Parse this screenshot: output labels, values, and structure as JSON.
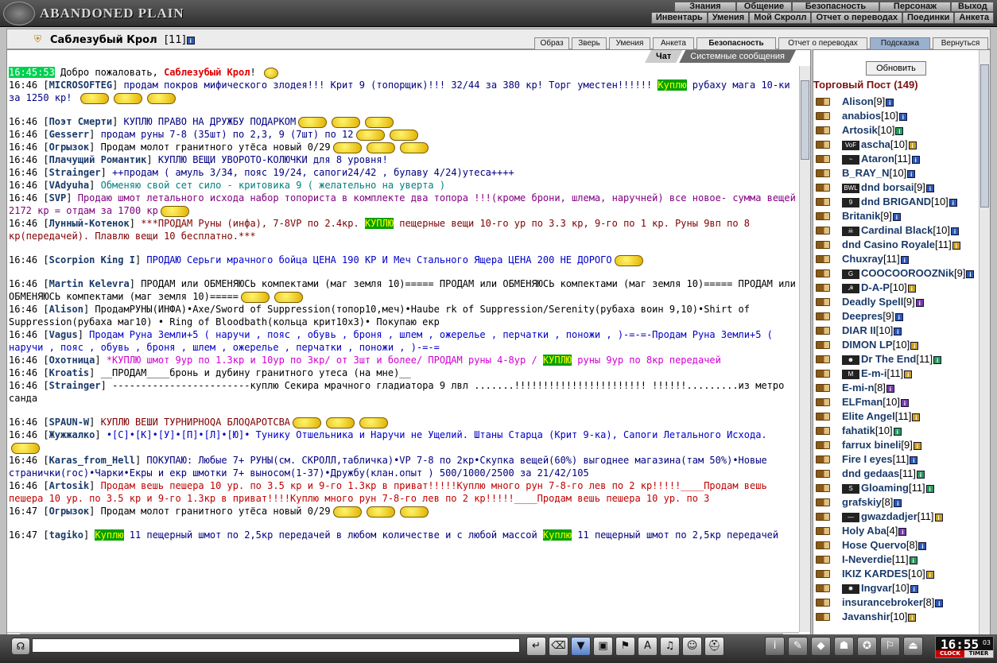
{
  "app": {
    "title": "ABANDONED PLAIN"
  },
  "nav_top": [
    "Знания",
    "Общение",
    "Безопасность",
    "Персонаж",
    "Выход"
  ],
  "nav_sub": [
    "Инвентарь",
    "Умения",
    "Мой Скролл",
    "Отчет о переводах",
    "Поединки",
    "Анкета"
  ],
  "header": {
    "player_name": "Саблезубый Крол",
    "level": "[11]",
    "info_icon": "i",
    "tabs": [
      {
        "label": "Образ",
        "bold": false
      },
      {
        "label": "Зверь",
        "bold": false
      },
      {
        "label": "Умения",
        "bold": false
      },
      {
        "label": "Анкета",
        "bold": false
      },
      {
        "label": "Безопасность",
        "bold": true
      },
      {
        "label": "Отчет о переводах",
        "bold": false
      },
      {
        "label": "Подсказка",
        "bold": false,
        "selected": true
      },
      {
        "label": "Вернуться",
        "bold": false
      }
    ]
  },
  "chat": {
    "tabs": [
      "Чат",
      "Системные сообщения"
    ],
    "welcome_time": "16:45:53",
    "welcome_prefix": "Добро пожаловать, ",
    "welcome_name": "Саблезубый Крол",
    "welcome_suffix": "!",
    "messages": [
      {
        "time": "16:46",
        "name": "MICROSOFTEG",
        "color": "navy",
        "parts": [
          {
            "t": "продам покров мифического злодея!!! Крит 9 (топорщик)!!! 32/44 за 380 кр! Торг уместен!!!!!! "
          },
          {
            "t": "Куплю",
            "hl": true
          },
          {
            "t": " рубаху мага 10-ки за 1250 кр! "
          }
        ],
        "emo": 3
      },
      {
        "time": "16:46",
        "name": "Поэт Смерти",
        "color": "navy",
        "parts": [
          {
            "t": "КУПЛЮ ПРАВО НА ДРУЖБУ ПОДАРКОМ"
          }
        ],
        "emo": 3,
        "gap": true
      },
      {
        "time": "16:46",
        "name": "Gesserr",
        "color": "navy",
        "parts": [
          {
            "t": "продам руны 7-8 (35шт) по 2,3, 9 (7шт) по 12"
          }
        ],
        "emo": 2
      },
      {
        "time": "16:46",
        "name": "Огрызок",
        "color": "black",
        "parts": [
          {
            "t": "Продам молот гранитного утёса новый 0/29"
          }
        ],
        "emo": 3
      },
      {
        "time": "16:46",
        "name": "Плачущий Романтик",
        "color": "navy",
        "parts": [
          {
            "t": "КУПЛЮ ВЕЩИ УВОРОТО-КОЛЮЧКИ для 8 уровня!"
          }
        ],
        "emo": 0
      },
      {
        "time": "16:46",
        "name": "Strainger",
        "color": "navy",
        "parts": [
          {
            "t": "++продам ( амуль 3/34, пояс 19/24, сапоги24/42 , булаву 4/24)утеса++++"
          }
        ],
        "emo": 0
      },
      {
        "time": "16:46",
        "name": "VAdyuha",
        "color": "teal",
        "parts": [
          {
            "t": "Обменяю свой сет сило - критовика 9 ( желательно на уверта )"
          }
        ],
        "emo": 0
      },
      {
        "time": "16:46",
        "name": "SVP",
        "color": "purple",
        "parts": [
          {
            "t": "Продаю шмот летального исхода набор топориста в комплекте два топора !!!(кроме брони, шлема, наручней) все новое- сумма вещей 2172 кр = отдам за 1700 кр"
          }
        ],
        "emo": 1
      },
      {
        "time": "16:46",
        "name": "Лунный-Котенок",
        "color": "maroon",
        "parts": [
          {
            "t": "***ПРОДАМ Руны (инфа), 7-8VP по 2.4кр. "
          },
          {
            "t": "КУПЛЮ",
            "hl": true
          },
          {
            "t": " пещерные вещи 10-го ур по 3.3 кр, 9-го по 1 кр. Руны 9вп по 8 кр(передачей). Плавлю вещи 10 бесплатно.***"
          }
        ],
        "emo": 0
      },
      {
        "time": "16:46",
        "name": "Scorpion King I",
        "color": "blue",
        "parts": [
          {
            "t": "ПРОДАЮ Серьги мрачного бойца ЦЕНА 190 КР И Меч Стального Ящера ЦЕНА 200 НЕ ДОРОГО"
          }
        ],
        "emo": 1,
        "gap": true
      },
      {
        "time": "16:46",
        "name": "Martin Kelevra",
        "color": "black",
        "parts": [
          {
            "t": "ПРОДАМ или ОБМЕНЯЮСЬ компектами (маг земля 10)===== ПРОДАМ или ОБМЕНЯЮСЬ компектами (маг земля 10)===== ПРОДАМ или ОБМЕНЯЮСЬ компектами (маг земля 10)====="
          }
        ],
        "emo": 2,
        "gap": true
      },
      {
        "time": "16:46",
        "name": "Alison",
        "color": "black",
        "parts": [
          {
            "t": "ПродамРУНЫ(ИНФА)•Axe/Sword of Suppression(топор10,меч)•Haube rk of Suppression/Serenity(рубаха воин 9,10)•Shirt of Suppression(рубаха маг10) • Ring of Bloodbath(кольца крит10x3)• Покупаю екр"
          }
        ],
        "emo": 0
      },
      {
        "time": "16:46",
        "name": "Vagus",
        "color": "blue",
        "parts": [
          {
            "t": "Продам Руна Земли+5 ( наручи , пояс , обувь , броня , шлем , ожерелье , перчатки , поножи , )-=-=-Продам Руна Земли+5 ( наручи , пояс , обувь , броня , шлем , ожерелье , перчатки , поножи , )-=-="
          }
        ],
        "emo": 0
      },
      {
        "time": "16:46",
        "name": "Охотница",
        "color": "magenta",
        "parts": [
          {
            "t": "*КУПЛЮ шмот 9ур по 1.3кр и 10ур по 3кр/ от 3шт и более/ ПРОДАМ руны 4-8ур / "
          },
          {
            "t": "КУПЛЮ",
            "hl": true
          },
          {
            "t": " руны 9ур по 8кр передачей"
          }
        ],
        "emo": 0
      },
      {
        "time": "16:46",
        "name": "Kroatis",
        "color": "black",
        "parts": [
          {
            "t": "__ПРОДАМ____бронь и дубину гранитного утеса (на мне)__"
          }
        ],
        "emo": 0
      },
      {
        "time": "16:46",
        "name": "Strainger",
        "color": "black",
        "parts": [
          {
            "t": "------------------------куплю Секира мрачного гладиатора 9 лвл .......!!!!!!!!!!!!!!!!!!!!!!! !!!!!!.........из метро санда"
          }
        ],
        "emo": 0
      },
      {
        "time": "16:46",
        "name": "SPAUN-W",
        "color": "maroon",
        "parts": [
          {
            "t": "КУПЛЮ ВЕШИ ТУРНИРНОQА БЛОQАРОТСВА"
          }
        ],
        "emo": 3,
        "gap": true
      },
      {
        "time": "16:46",
        "name": "Жужжалко",
        "color": "blue",
        "parts": [
          {
            "t": "•[С]•[К]•[У]•[П]•[Л]•[Ю]• Тунику Отшельника и Наручи не Ущелий. Штаны Старца (Крит 9-ка), Сапоги Летального Исхода."
          }
        ],
        "emo": 1
      },
      {
        "time": "16:46",
        "name": "Karas_from_Hell",
        "color": "navy",
        "parts": [
          {
            "t": "ПОКУПАЮ: Любые 7+ РУНЫ(см. СКРОЛЛ,табличка)•VP 7-8 по 2кр•Скупка вещей(60%) выгоднее магазина(там 50%)•Новые странички(гос)•Чарки•Екры и екр шмотки 7+ выносом(1-37)•Дружбу(клан.опыт ) 500/1000/2500 за 21/42/105"
          }
        ],
        "emo": 0
      },
      {
        "time": "16:46",
        "name": "Artosik",
        "color": "red",
        "parts": [
          {
            "t": "Продам вешь пешера 10 ур. по 3.5 кр и 9-го 1.3кр в приват!!!!!Куплю много рун 7-8-го лев по 2 кр!!!!!____Продам вешь пешера 10 ур. по 3.5 кр и 9-го 1.3кр в приват!!!!Куплю много рун 7-8-го лев по 2 кр!!!!!____Продам вешь пешера 10 ур. по 3"
          }
        ],
        "emo": 0
      },
      {
        "time": "16:47",
        "name": "Огрызок",
        "color": "black",
        "parts": [
          {
            "t": "Продам молот гранитного утёса новый 0/29"
          }
        ],
        "emo": 3
      },
      {
        "time": "16:47",
        "name": "tagiko",
        "color": "navy",
        "parts": [
          {
            "t": " "
          },
          {
            "t": "Куплю",
            "hl": true
          },
          {
            "t": " 11 пещерный шмот по 2,5кр передачей  в любом количестве и с любой массой  "
          },
          {
            "t": "Куплю",
            "hl": true
          },
          {
            "t": " 11 пещерный шмот по 2,5кр передачей"
          }
        ],
        "emo": 0,
        "gap": true
      }
    ],
    "input_placeholder": ""
  },
  "trade_post": {
    "refresh_label": "Обновить",
    "title": "Торговый Пост (149)",
    "players": [
      {
        "name": "Alison",
        "level": "[9]",
        "info": "b"
      },
      {
        "name": "anabios",
        "level": "[10]",
        "info": "b"
      },
      {
        "name": "Artosik",
        "level": "[10]",
        "info": "g"
      },
      {
        "name": "ascha",
        "level": "[10]",
        "info": "y",
        "clan": "VoF"
      },
      {
        "name": "Ataron",
        "level": "[11]",
        "info": "b",
        "clan": "~"
      },
      {
        "name": "B_RAY_N",
        "level": "[10]",
        "info": "b"
      },
      {
        "name": "dnd borsai",
        "level": "[9]",
        "info": "b",
        "clan": "BWL"
      },
      {
        "name": "dnd BRIGAND",
        "level": "[10]",
        "info": "b",
        "clan": "9"
      },
      {
        "name": "Britanik",
        "level": "[9]",
        "info": "b"
      },
      {
        "name": "Cardinal Black",
        "level": "[10]",
        "info": "b",
        "clan": "☠"
      },
      {
        "name": "dnd Casino Royale",
        "level": "[11]",
        "info": "y"
      },
      {
        "name": "Chuxray",
        "level": "[11]",
        "info": "b"
      },
      {
        "name": "COOCOOROOZNik",
        "level": "[9]",
        "info": "b",
        "clan": "G"
      },
      {
        "name": "D-A-P",
        "level": "[10]",
        "info": "y",
        "clan": "☭"
      },
      {
        "name": "Deadly Spell",
        "level": "[9]",
        "info": "p"
      },
      {
        "name": "Deepres",
        "level": "[9]",
        "info": "b"
      },
      {
        "name": "DIAR II",
        "level": "[10]",
        "info": "b"
      },
      {
        "name": "DIMON LP",
        "level": "[10]",
        "info": "y"
      },
      {
        "name": "Dr The End",
        "level": "[11]",
        "info": "g",
        "clan": "☻"
      },
      {
        "name": "E-m-i",
        "level": "[11]",
        "info": "y",
        "clan": "M"
      },
      {
        "name": "E-mi-n",
        "level": "[8]",
        "info": "p"
      },
      {
        "name": "ELFman",
        "level": "[10]",
        "info": "p"
      },
      {
        "name": "Elite Angel",
        "level": "[11]",
        "info": "y"
      },
      {
        "name": "fahatik",
        "level": "[10]",
        "info": "g"
      },
      {
        "name": "farrux bineli",
        "level": "[9]",
        "info": "y"
      },
      {
        "name": "Fire I eyes",
        "level": "[11]",
        "info": "b"
      },
      {
        "name": "dnd gedaas",
        "level": "[11]",
        "info": "g"
      },
      {
        "name": "Gloaming",
        "level": "[11]",
        "info": "g",
        "clan": "S"
      },
      {
        "name": "grafskiy",
        "level": "[8]",
        "info": "b"
      },
      {
        "name": "gwazdadjer",
        "level": "[11]",
        "info": "y",
        "clan": "—"
      },
      {
        "name": "Holy Aba",
        "level": "[4]",
        "info": "p"
      },
      {
        "name": "Hose Quervo",
        "level": "[8]",
        "info": "b"
      },
      {
        "name": "I-Neverdie",
        "level": "[11]",
        "info": "g"
      },
      {
        "name": "IKIZ KARDES",
        "level": "[10]",
        "info": "y"
      },
      {
        "name": "Ingvar",
        "level": "[10]",
        "info": "b",
        "clan": "✹"
      },
      {
        "name": "insurancebroker",
        "level": "[8]",
        "info": "b"
      },
      {
        "name": "Javanshir",
        "level": "[10]",
        "info": "y"
      }
    ]
  },
  "toolbar": {
    "icons": [
      "enter-icon",
      "eraser-icon",
      "filter-icon",
      "save-icon",
      "run-icon",
      "translit-icon",
      "sound-icon",
      "smile-icon",
      "helmet-icon"
    ],
    "icons2": [
      "info-icon",
      "scroll-icon",
      "bag-icon",
      "group-icon",
      "clan-icon",
      "flag-icon",
      "exit-icon"
    ],
    "clock_time": "16:55",
    "clock_sec": "03",
    "clock_label1": "CLOCK",
    "clock_label2": "TIMER"
  }
}
